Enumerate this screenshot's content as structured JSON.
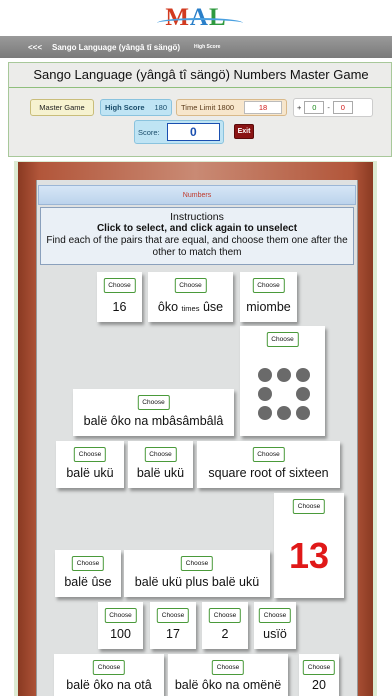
{
  "logo": {
    "m": "M",
    "a": "A",
    "l": "L"
  },
  "nav": {
    "back": "<<<",
    "title": "Sango Language (yângâ tî sängö)",
    "high_scores": "High Score"
  },
  "game": {
    "title": "Sango Language (yângâ tî sängö) Numbers Master Game",
    "master_game_label": "Master Game",
    "high_score_label": "High Score",
    "high_score_value": "180",
    "time_limit_label": "Time Limit 1800",
    "time_limit_value": "18",
    "plus_sign": "+",
    "plus_value": "0",
    "minus_sign": "-",
    "minus_value": "0",
    "score_label": "Score:",
    "score_value": "0",
    "exit_label": "Exit"
  },
  "board": {
    "tab_label": "Numbers",
    "instructions": {
      "heading": "Instructions",
      "bold": "Click to select, and click again to unselect",
      "text": "Find each of the pairs that are equal, and choose them one after the other to match them"
    },
    "choose_label": "Choose",
    "cards": [
      {
        "text": "16"
      },
      {
        "text_main": "ôko",
        "text_small": "times",
        "text_end": "ûse"
      },
      {
        "text": "miombe"
      },
      {
        "dots": 8
      },
      {
        "text": "balë ôko na mbâsâmbâlâ"
      },
      {
        "text": "balë ukü"
      },
      {
        "text": "balë ukü"
      },
      {
        "text": "square root of sixteen"
      },
      {
        "text": "13"
      },
      {
        "text": "balë ûse"
      },
      {
        "text": "balë ukü plus balë ukü"
      },
      {
        "text": "100"
      },
      {
        "text": "17"
      },
      {
        "text": "2"
      },
      {
        "text": "usïö"
      },
      {
        "text": "balë ôko na otâ"
      },
      {
        "text": "balë ôko na omënë"
      },
      {
        "text": "20"
      }
    ]
  },
  "colors": {
    "accent_red": "#e01818",
    "score_blue": "#1a4fb0",
    "exit_red": "#8a1414",
    "choose_border": "#4a9a3a"
  }
}
